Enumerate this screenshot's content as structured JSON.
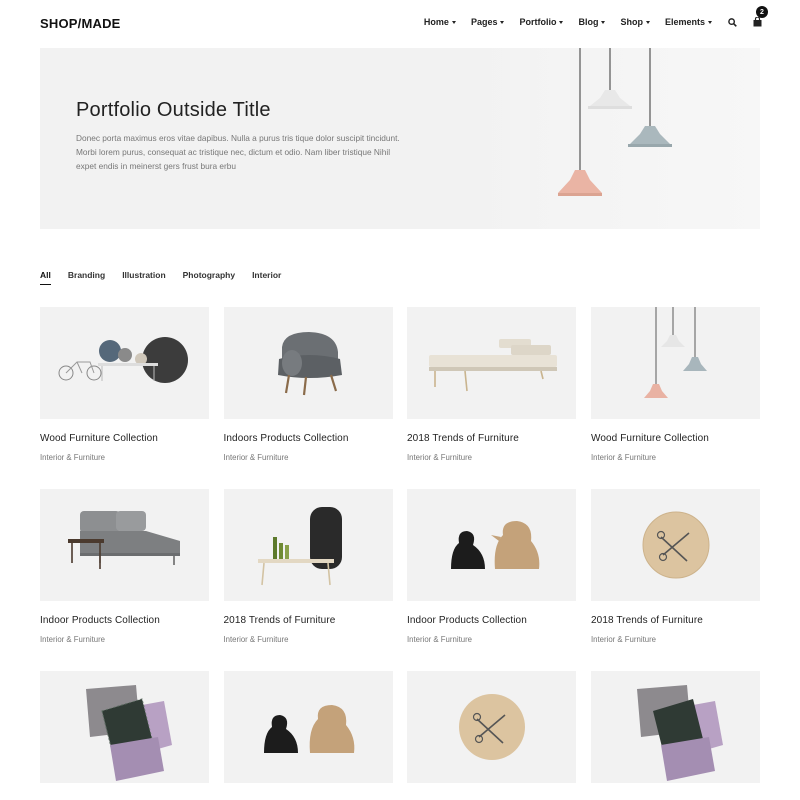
{
  "header": {
    "logo": "SHOP/MADE",
    "nav": [
      "Home",
      "Pages",
      "Portfolio",
      "Blog",
      "Shop",
      "Elements"
    ],
    "search_icon": "search-icon",
    "cart_icon": "shopping-bag-icon",
    "cart_count": "2"
  },
  "hero": {
    "title": "Portfolio Outside Title",
    "description": "Donec porta maximus eros vitae dapibus. Nulla a purus tris tique dolor suscipit tincidunt. Morbi lorem purus, consequat ac tristique nec, dictum et odio. Nam liber tristique Nihil expet endis in meinerst gers frust bura erbu"
  },
  "filters": [
    "All",
    "Branding",
    "Illustration",
    "Photography",
    "Interior"
  ],
  "active_filter": "All",
  "portfolio": [
    {
      "title": "Wood Furniture Collection",
      "category": "Interior & Furniture",
      "image": "bicycle-table-discs"
    },
    {
      "title": "Indoors Products Collection",
      "category": "Interior & Furniture",
      "image": "grey-armchair"
    },
    {
      "title": "2018 Trends of Furniture",
      "category": "Interior & Furniture",
      "image": "daybed"
    },
    {
      "title": "Wood Furniture Collection",
      "category": "Interior & Furniture",
      "image": "pendant-lamps"
    },
    {
      "title": "Indoor Products Collection",
      "category": "Interior & Furniture",
      "image": "chaise-sofa"
    },
    {
      "title": "2018 Trends of Furniture",
      "category": "Interior & Furniture",
      "image": "bench-with-vases"
    },
    {
      "title": "Indoor Products Collection",
      "category": "Interior & Furniture",
      "image": "bird-figures"
    },
    {
      "title": "2018 Trends of Furniture",
      "category": "Interior & Furniture",
      "image": "wooden-clock"
    },
    {
      "title": "",
      "category": "",
      "image": "cushions"
    },
    {
      "title": "",
      "category": "",
      "image": "bird-figures"
    },
    {
      "title": "",
      "category": "",
      "image": "wooden-clock"
    },
    {
      "title": "",
      "category": "",
      "image": "cushions"
    }
  ],
  "colors": {
    "panel_bg": "#f2f2f2",
    "text_dark": "#222222",
    "text_muted": "#777777",
    "lamp_white": "#e6e6e6",
    "lamp_blue": "#a8b6bc",
    "lamp_pink": "#e9b2a3"
  }
}
